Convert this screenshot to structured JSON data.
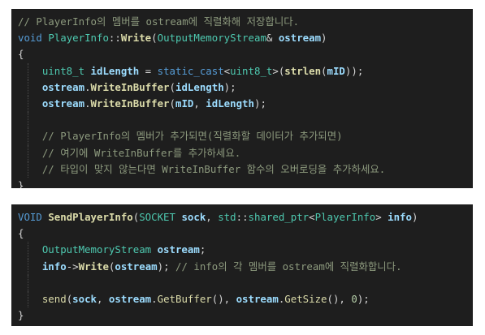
{
  "colors": {
    "background": "#1e1e1e",
    "keyword": "#569cd6",
    "type": "#4ec9b0",
    "function": "#dcdcaa",
    "variable": "#9cdcfe",
    "comment": "#8d9a7e",
    "number": "#b5cea8",
    "punctuation": "#d4d4d4"
  },
  "panels": [
    {
      "lines": [
        {
          "indent": 0,
          "tokens": [
            {
              "t": "// PlayerInfo의 멤버를 ostream에 직렬화해 저장합니다.",
              "c": "cm"
            }
          ]
        },
        {
          "indent": 0,
          "tokens": [
            {
              "t": "void",
              "c": "kw"
            },
            {
              "t": " ",
              "c": "pu"
            },
            {
              "t": "PlayerInfo",
              "c": "type"
            },
            {
              "t": "::",
              "c": "pu"
            },
            {
              "t": "Write",
              "c": "fn"
            },
            {
              "t": "(",
              "c": "pu"
            },
            {
              "t": "OutputMemoryStream",
              "c": "type"
            },
            {
              "t": "& ",
              "c": "pu"
            },
            {
              "t": "ostream",
              "c": "var"
            },
            {
              "t": ")",
              "c": "pu"
            }
          ]
        },
        {
          "indent": 0,
          "tokens": [
            {
              "t": "{",
              "c": "pu"
            }
          ]
        },
        {
          "indent": 1,
          "tokens": [
            {
              "t": "uint8_t",
              "c": "type"
            },
            {
              "t": " ",
              "c": "pu"
            },
            {
              "t": "idLength",
              "c": "var"
            },
            {
              "t": " = ",
              "c": "op"
            },
            {
              "t": "static_cast",
              "c": "kw"
            },
            {
              "t": "<",
              "c": "pu"
            },
            {
              "t": "uint8_t",
              "c": "type"
            },
            {
              "t": ">(",
              "c": "pu"
            },
            {
              "t": "strlen",
              "c": "fn"
            },
            {
              "t": "(",
              "c": "pu"
            },
            {
              "t": "mID",
              "c": "var"
            },
            {
              "t": "));",
              "c": "pu"
            }
          ]
        },
        {
          "indent": 1,
          "tokens": [
            {
              "t": "ostream",
              "c": "var"
            },
            {
              "t": ".",
              "c": "pu"
            },
            {
              "t": "WriteInBuffer",
              "c": "fn"
            },
            {
              "t": "(",
              "c": "pu"
            },
            {
              "t": "idLength",
              "c": "var"
            },
            {
              "t": ");",
              "c": "pu"
            }
          ]
        },
        {
          "indent": 1,
          "tokens": [
            {
              "t": "ostream",
              "c": "var"
            },
            {
              "t": ".",
              "c": "pu"
            },
            {
              "t": "WriteInBuffer",
              "c": "fn"
            },
            {
              "t": "(",
              "c": "pu"
            },
            {
              "t": "mID",
              "c": "var"
            },
            {
              "t": ", ",
              "c": "pu"
            },
            {
              "t": "idLength",
              "c": "var"
            },
            {
              "t": ");",
              "c": "pu"
            }
          ]
        },
        {
          "indent": 1,
          "tokens": []
        },
        {
          "indent": 1,
          "tokens": [
            {
              "t": "// PlayerInfo의 멤버가 추가되면(직렬화할 데이터가 추가되면)",
              "c": "cm"
            }
          ]
        },
        {
          "indent": 1,
          "tokens": [
            {
              "t": "// 여기에 WriteInBuffer를 추가하세요.",
              "c": "cm"
            }
          ]
        },
        {
          "indent": 1,
          "tokens": [
            {
              "t": "// 타입이 맞지 않는다면 WriteInBuffer 함수의 오버로딩을 추가하세요.",
              "c": "cm"
            }
          ]
        },
        {
          "indent": 0,
          "tokens": [
            {
              "t": "}",
              "c": "pu"
            }
          ]
        }
      ]
    },
    {
      "lines": [
        {
          "indent": 0,
          "tokens": [
            {
              "t": "VOID",
              "c": "kw"
            },
            {
              "t": " ",
              "c": "pu"
            },
            {
              "t": "SendPlayerInfo",
              "c": "fn"
            },
            {
              "t": "(",
              "c": "pu"
            },
            {
              "t": "SOCKET",
              "c": "type"
            },
            {
              "t": " ",
              "c": "pu"
            },
            {
              "t": "sock",
              "c": "var"
            },
            {
              "t": ", ",
              "c": "pu"
            },
            {
              "t": "std",
              "c": "type"
            },
            {
              "t": "::",
              "c": "pu"
            },
            {
              "t": "shared_ptr",
              "c": "type"
            },
            {
              "t": "<",
              "c": "pu"
            },
            {
              "t": "PlayerInfo",
              "c": "type"
            },
            {
              "t": "> ",
              "c": "pu"
            },
            {
              "t": "info",
              "c": "var"
            },
            {
              "t": ")",
              "c": "pu"
            }
          ]
        },
        {
          "indent": 0,
          "tokens": [
            {
              "t": "{",
              "c": "pu"
            }
          ]
        },
        {
          "indent": 1,
          "tokens": [
            {
              "t": "OutputMemoryStream",
              "c": "type"
            },
            {
              "t": " ",
              "c": "pu"
            },
            {
              "t": "ostream",
              "c": "var"
            },
            {
              "t": ";",
              "c": "pu"
            }
          ]
        },
        {
          "indent": 1,
          "tokens": [
            {
              "t": "info",
              "c": "var"
            },
            {
              "t": "->",
              "c": "pu"
            },
            {
              "t": "Write",
              "c": "fn"
            },
            {
              "t": "(",
              "c": "pu"
            },
            {
              "t": "ostream",
              "c": "var"
            },
            {
              "t": "); ",
              "c": "pu"
            },
            {
              "t": "// info의 각 멤버를 ostream에 직렬화합니다.",
              "c": "cm"
            }
          ]
        },
        {
          "indent": 1,
          "tokens": []
        },
        {
          "indent": 1,
          "tokens": [
            {
              "t": "send",
              "c": "fnp"
            },
            {
              "t": "(",
              "c": "pu"
            },
            {
              "t": "sock",
              "c": "var"
            },
            {
              "t": ", ",
              "c": "pu"
            },
            {
              "t": "ostream",
              "c": "var"
            },
            {
              "t": ".",
              "c": "pu"
            },
            {
              "t": "GetBuffer",
              "c": "fnp"
            },
            {
              "t": "(), ",
              "c": "pu"
            },
            {
              "t": "ostream",
              "c": "var"
            },
            {
              "t": ".",
              "c": "pu"
            },
            {
              "t": "GetSize",
              "c": "fnp"
            },
            {
              "t": "(), ",
              "c": "pu"
            },
            {
              "t": "0",
              "c": "num"
            },
            {
              "t": ");",
              "c": "pu"
            }
          ]
        },
        {
          "indent": 0,
          "tokens": [
            {
              "t": "}",
              "c": "pu"
            }
          ]
        }
      ]
    }
  ]
}
